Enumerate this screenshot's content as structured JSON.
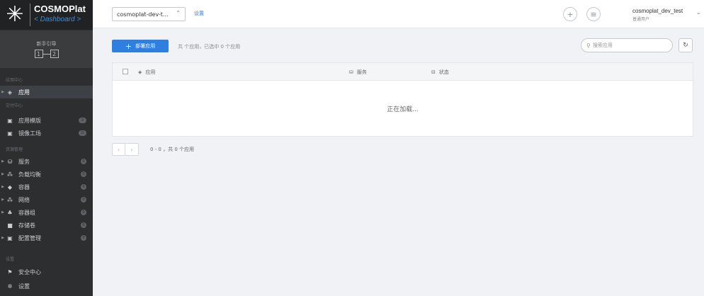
{
  "sidebar": {
    "logo": {
      "name": "COSMOPlat",
      "sub": "< Dashboard >"
    },
    "guide": {
      "label": "新手引导",
      "step1": "1",
      "step2": "2"
    },
    "sections": [
      {
        "title": "应用中心"
      },
      {
        "title": "交付中心"
      },
      {
        "title": "资源管理"
      },
      {
        "title": "设置"
      }
    ],
    "items": [
      {
        "label": "应用",
        "icon": "layers-icon"
      },
      {
        "label": "应用模版",
        "icon": "template-icon",
        "badge": "0"
      },
      {
        "label": "镜像工场",
        "icon": "image-icon",
        "badge": "0"
      },
      {
        "label": "服务",
        "icon": "service-icon",
        "badge": "0"
      },
      {
        "label": "负载均衡",
        "icon": "loadbalance-icon",
        "badge": "0"
      },
      {
        "label": "容器",
        "icon": "container-icon",
        "badge": "0"
      },
      {
        "label": "网络",
        "icon": "network-icon",
        "badge": "0"
      },
      {
        "label": "容器组",
        "icon": "container-group-icon",
        "badge": "0"
      },
      {
        "label": "存储卷",
        "icon": "storage-icon",
        "badge": "0"
      },
      {
        "label": "配置管理",
        "icon": "config-icon",
        "badge": "0"
      },
      {
        "label": "安全中心",
        "icon": "security-icon"
      },
      {
        "label": "设置",
        "icon": "settings-icon"
      }
    ]
  },
  "header": {
    "cluster": "cosmoplat-dev-t...",
    "settings_link": "设置",
    "username": "cosmoplat_dev_test",
    "role": "普通用户"
  },
  "toolbar": {
    "deploy_label": "部署应用",
    "count_text": "共 个应用，已选中 0 个应用",
    "search_placeholder": "搜索应用"
  },
  "table": {
    "columns": [
      "应用",
      "服务",
      "状态"
    ],
    "loading": "正在加载..."
  },
  "pagination": {
    "info": "0 - 0 ，共 0 个应用"
  },
  "colors": {
    "accent": "#2f7fe0",
    "sidebar_bg": "#2c2e30"
  }
}
